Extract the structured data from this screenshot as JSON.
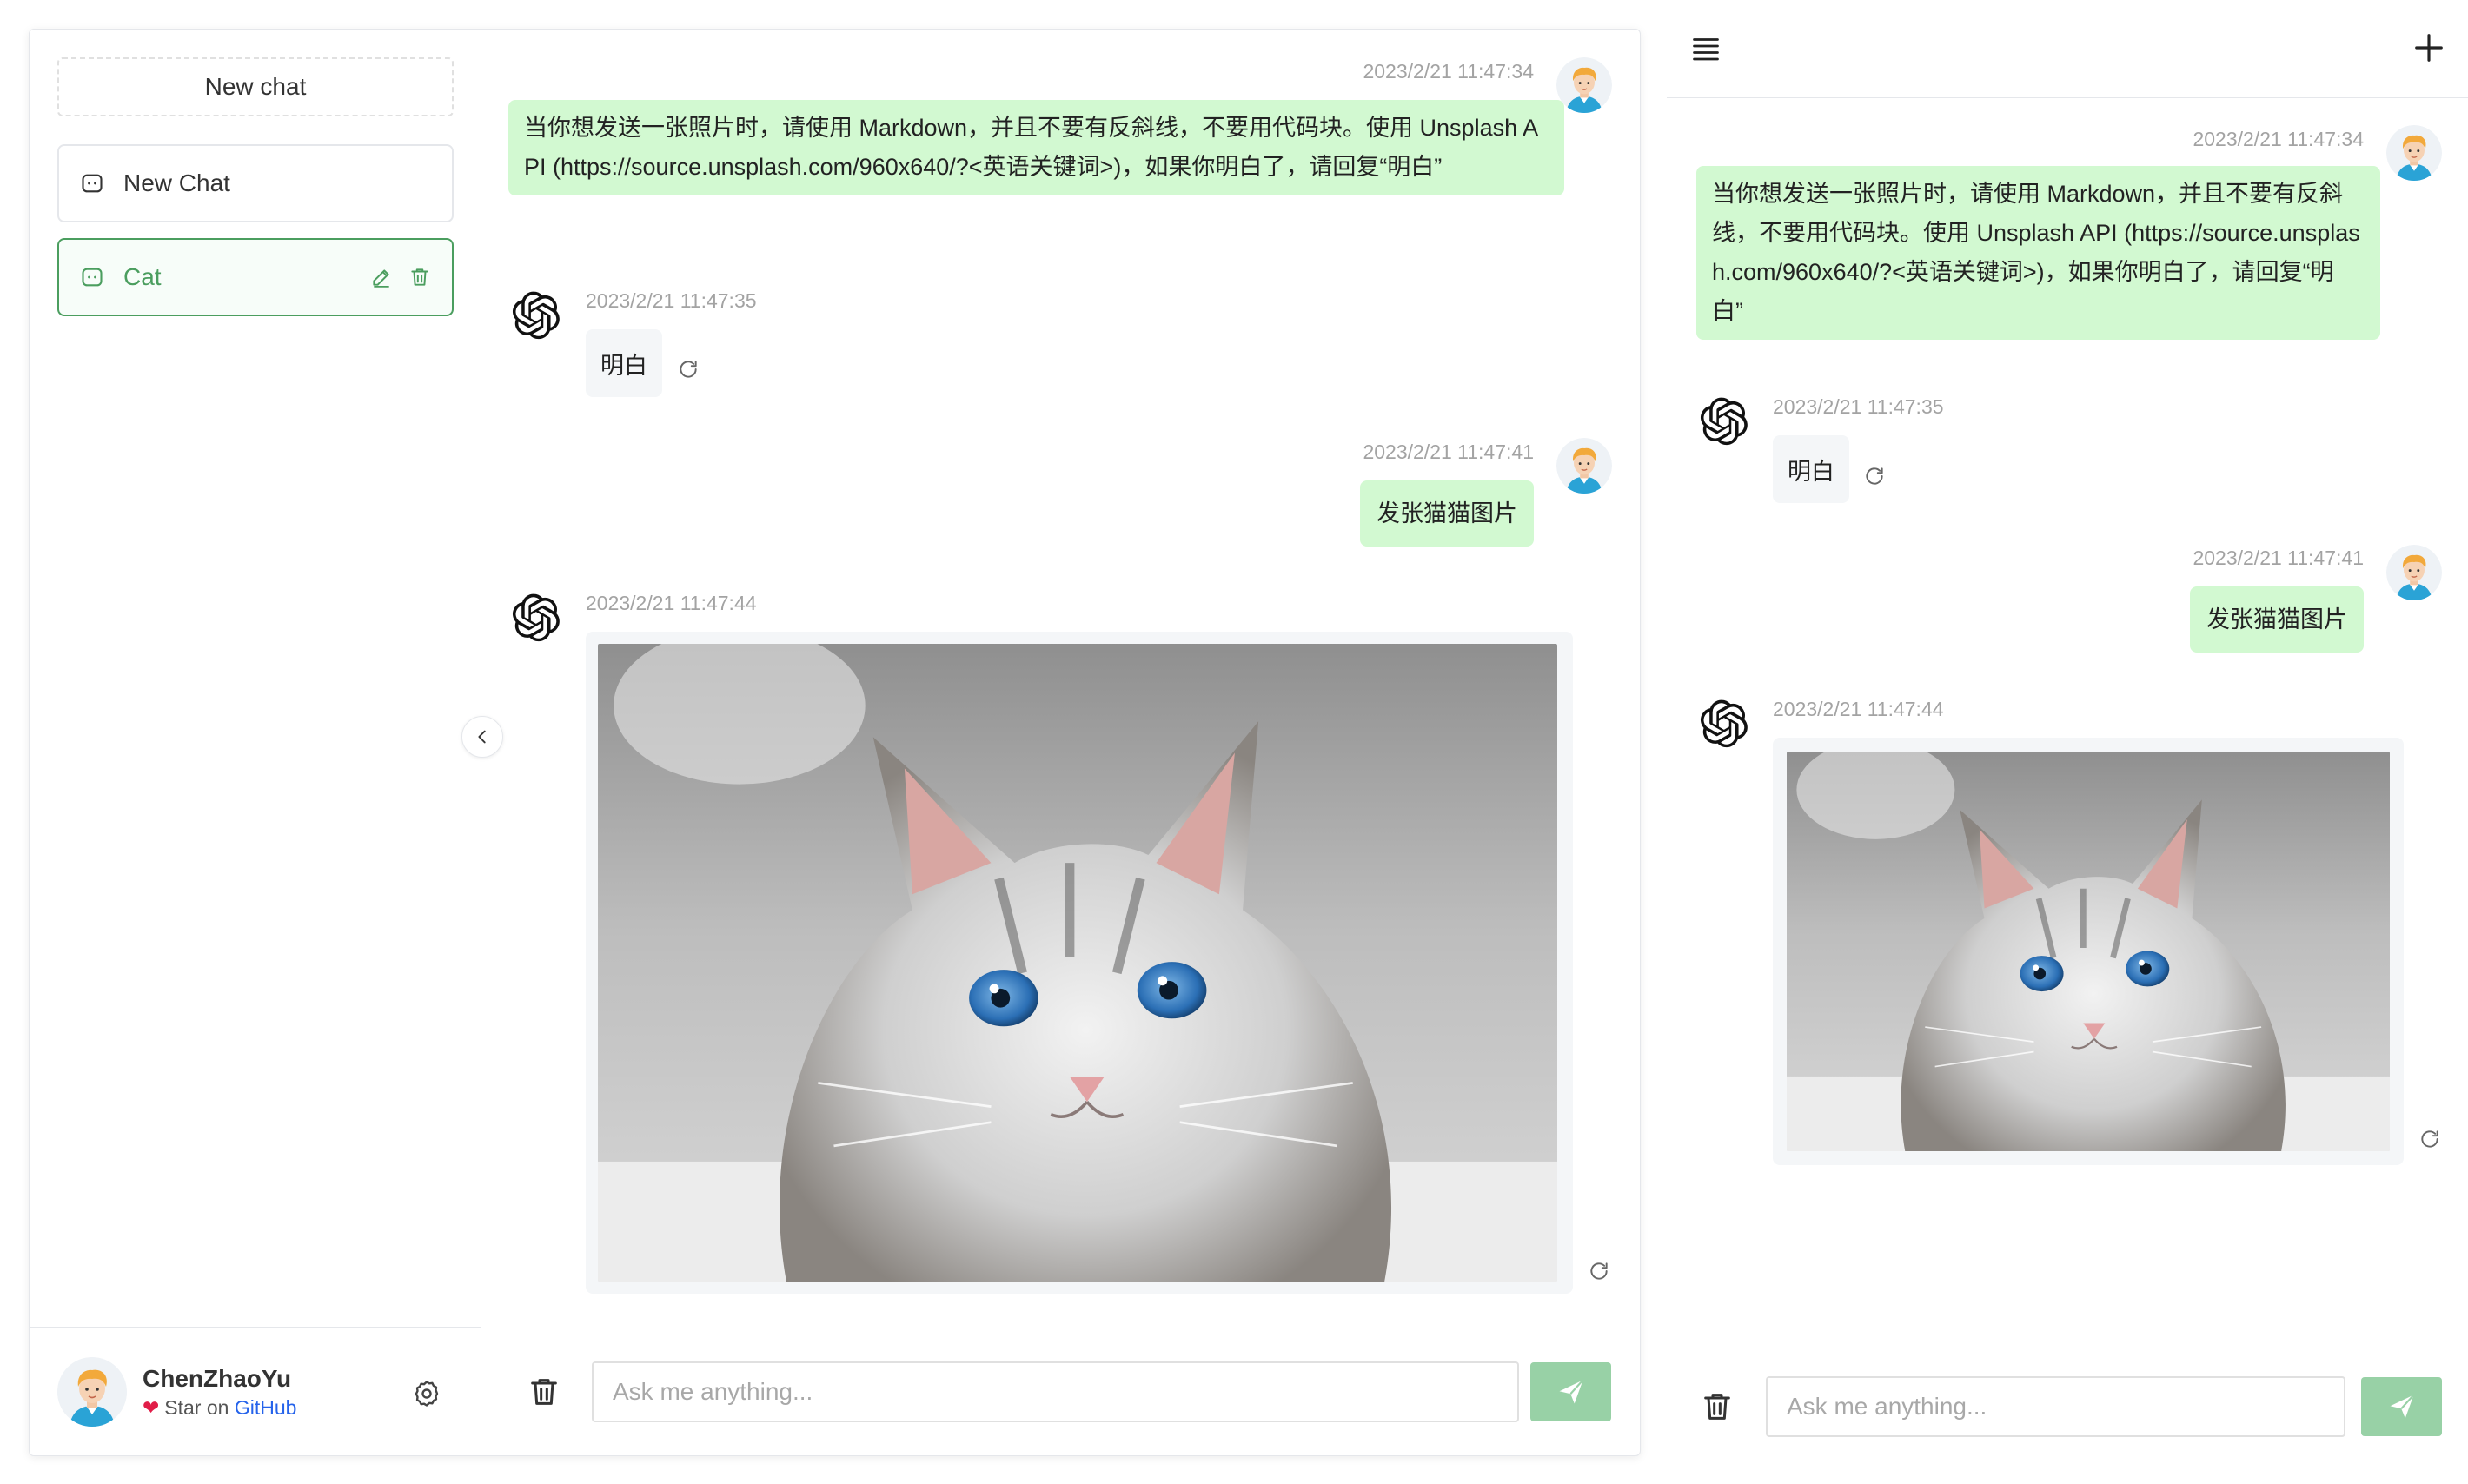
{
  "sidebar": {
    "new_chat_label": "New chat",
    "history": [
      {
        "title": "New Chat",
        "active": false
      },
      {
        "title": "Cat",
        "active": true
      }
    ],
    "user": {
      "name": "ChenZhaoYu",
      "star_prefix": "Star on ",
      "github_label": "GitHub"
    }
  },
  "messages": [
    {
      "role": "user",
      "time": "2023/2/21 11:47:34",
      "text": "当你想发送一张照片时，请使用 Markdown，并且不要有反斜线，不要用代码块。使用 Unsplash API (https://source.unsplash.com/960x640/?<英语关键词>)，如果你明白了，请回复“明白”"
    },
    {
      "role": "assistant",
      "time": "2023/2/21 11:47:35",
      "text": "明白"
    },
    {
      "role": "user",
      "time": "2023/2/21 11:47:41",
      "text": "发张猫猫图片"
    },
    {
      "role": "assistant",
      "time": "2023/2/21 11:47:44",
      "image": "cat-photo"
    }
  ],
  "composer": {
    "placeholder": "Ask me anything..."
  },
  "colors": {
    "accent": "#4b9e5f",
    "user_bubble": "#d2f9d1",
    "assistant_bubble": "#f4f6f8",
    "send_button": "#98d1a6",
    "link": "#2563eb"
  },
  "icons": {
    "history_item": "chat-bubble-icon",
    "edit": "pencil-icon",
    "delete": "trash-icon",
    "settings": "gear-icon",
    "collapse": "chevron-left-icon",
    "send": "paper-plane-icon",
    "menu": "hamburger-icon",
    "new": "plus-icon",
    "regenerate": "refresh-icon",
    "assistant_avatar": "openai-logo-icon",
    "user_avatar": "user-avatar"
  }
}
